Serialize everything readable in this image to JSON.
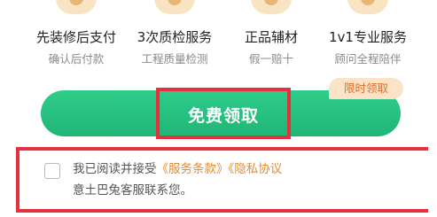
{
  "features": [
    {
      "title": "先装修后支付",
      "subtitle": "确认后付款",
      "icon": "wallet-icon"
    },
    {
      "title": "3次质检服务",
      "subtitle": "工程质量检测",
      "icon": "inspection-icon"
    },
    {
      "title": "正品辅材",
      "subtitle": "假一赔十",
      "icon": "materials-icon"
    },
    {
      "title": "1v1专业服务",
      "subtitle": "顾问全程陪伴",
      "icon": "advisor-icon"
    }
  ],
  "cta": {
    "label": "免费领取",
    "badge": "限时领取"
  },
  "agreement": {
    "prefix": "我已阅读并接受",
    "terms_link": "《服务条款》",
    "privacy_link": "《隐私协议",
    "suffix_line": "意土巴兔客服联系您。"
  },
  "colors": {
    "primary_green": "#1fb676",
    "highlight_red": "#e5313f",
    "link_orange": "#e88a2a",
    "badge_bg": "#fbe3c8"
  }
}
